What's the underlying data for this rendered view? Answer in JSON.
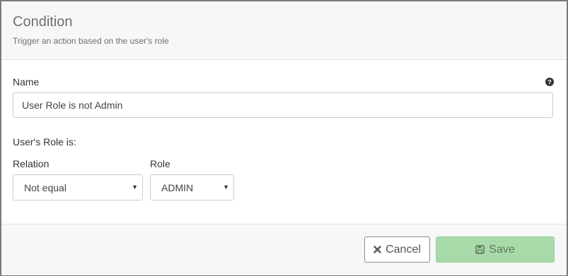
{
  "dialog": {
    "title": "Condition",
    "subtitle": "Trigger an action based on the user's role"
  },
  "form": {
    "name_label": "Name",
    "name_value": "User Role is not Admin",
    "help_icon": "question-circle-icon",
    "section_label": "User's Role is:",
    "relation_label": "Relation",
    "relation_value": "Not equal",
    "role_label": "Role",
    "role_value": "ADMIN"
  },
  "footer": {
    "cancel_label": "Cancel",
    "cancel_icon": "times-icon",
    "save_label": "Save",
    "save_icon": "floppy-disk-icon"
  },
  "colors": {
    "save_button_bg": "#a8d9a8",
    "header_bg": "#f7f7f7"
  }
}
